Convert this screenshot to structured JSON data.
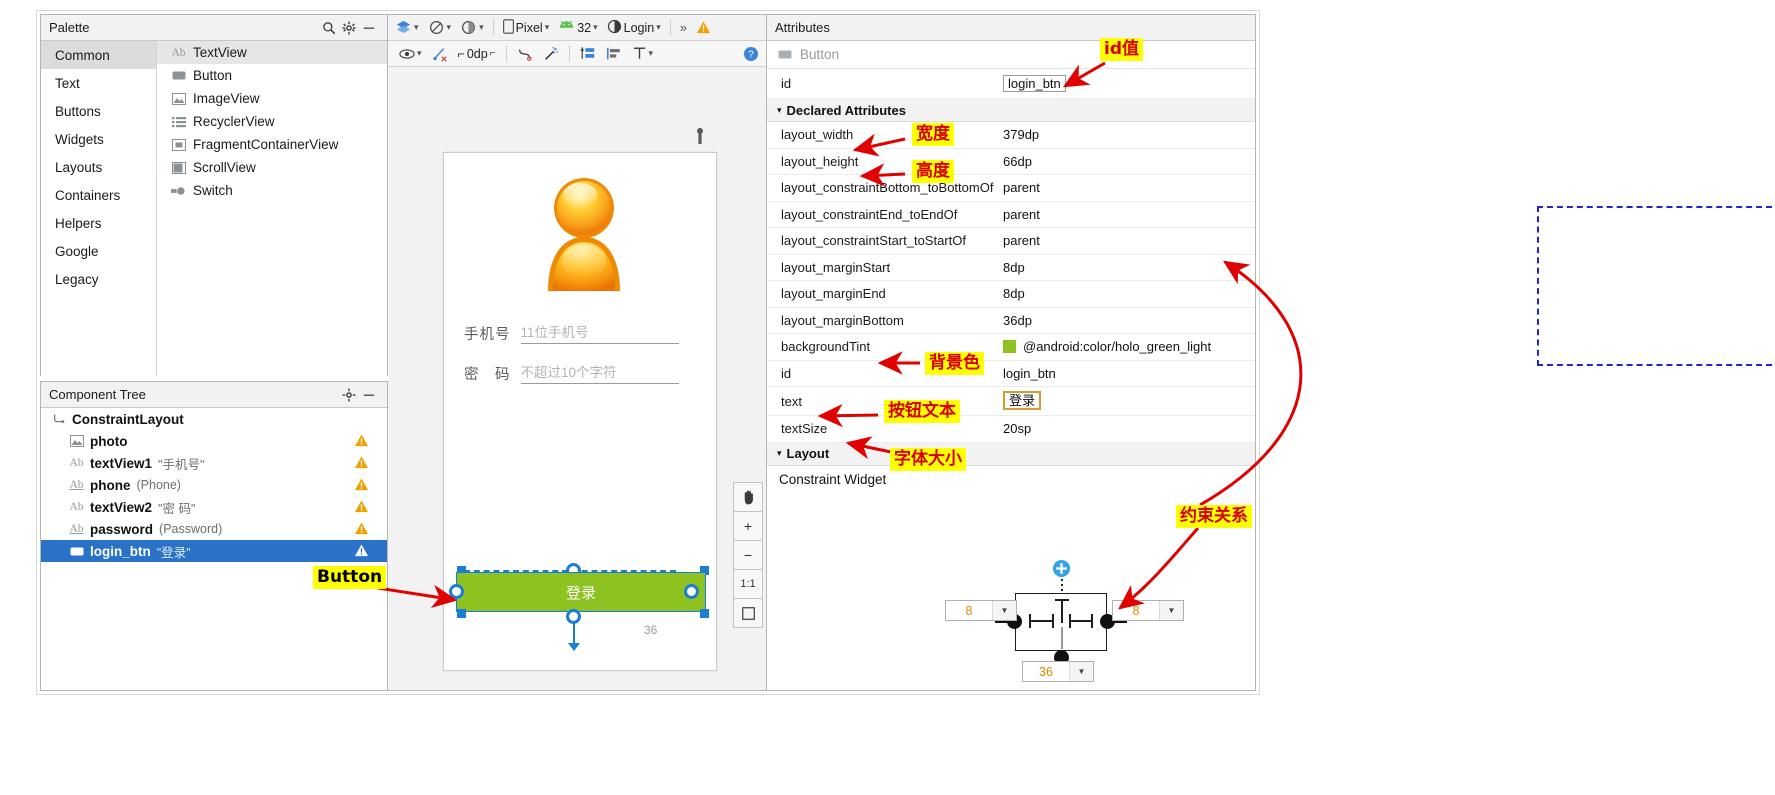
{
  "palette": {
    "title": "Palette",
    "icons": [
      "search-icon",
      "gear-icon",
      "minimize-icon"
    ],
    "categories": [
      {
        "label": "Common",
        "selected": true
      },
      {
        "label": "Text",
        "selected": false
      },
      {
        "label": "Buttons",
        "selected": false
      },
      {
        "label": "Widgets",
        "selected": false
      },
      {
        "label": "Layouts",
        "selected": false
      },
      {
        "label": "Containers",
        "selected": false
      },
      {
        "label": "Helpers",
        "selected": false
      },
      {
        "label": "Google",
        "selected": false
      },
      {
        "label": "Legacy",
        "selected": false
      }
    ],
    "items": [
      {
        "label": "TextView",
        "icon": "textview-icon",
        "selected": true
      },
      {
        "label": "Button",
        "icon": "button-icon",
        "selected": false
      },
      {
        "label": "ImageView",
        "icon": "imageview-icon",
        "selected": false
      },
      {
        "label": "RecyclerView",
        "icon": "recyclerview-icon",
        "selected": false
      },
      {
        "label": "FragmentContainerView",
        "icon": "fragment-icon",
        "selected": false
      },
      {
        "label": "ScrollView",
        "icon": "scrollview-icon",
        "selected": false
      },
      {
        "label": "Switch",
        "icon": "switch-icon",
        "selected": false
      }
    ]
  },
  "component_tree": {
    "title": "Component Tree",
    "icons": [
      "gear-icon",
      "minimize-icon"
    ],
    "nodes": [
      {
        "name": "ConstraintLayout",
        "qualifier": "",
        "icon": "constraintlayout-icon",
        "warning": false,
        "selected": false,
        "indent": 0
      },
      {
        "name": "photo",
        "qualifier": "",
        "icon": "imageview-icon",
        "warning": true,
        "selected": false,
        "indent": 1
      },
      {
        "name": "textView1",
        "qualifier": "\"手机号\"",
        "icon": "textview-icon",
        "warning": true,
        "selected": false,
        "indent": 1
      },
      {
        "name": "phone",
        "qualifier": "(Phone)",
        "icon": "edittext-icon",
        "warning": true,
        "selected": false,
        "indent": 1
      },
      {
        "name": "textView2",
        "qualifier": "\"密  码\"",
        "icon": "textview-icon",
        "warning": true,
        "selected": false,
        "indent": 1
      },
      {
        "name": "password",
        "qualifier": "(Password)",
        "icon": "edittext-icon",
        "warning": true,
        "selected": false,
        "indent": 1
      },
      {
        "name": "login_btn",
        "qualifier": "\"登录\"",
        "icon": "button-icon",
        "warning": true,
        "selected": true,
        "indent": 1
      }
    ]
  },
  "editor_toolbar": {
    "row1": [
      {
        "label": "",
        "icon": "layers-icon"
      },
      {
        "label": "",
        "icon": "orientation-icon"
      },
      {
        "label": "",
        "icon": "theme-icon"
      },
      {
        "label": "Pixel",
        "icon": "device-icon"
      },
      {
        "label": "32",
        "icon": "android-api-icon"
      },
      {
        "label": "Login",
        "icon": "theme-contrast-icon"
      },
      {
        "label": "»",
        "icon": "overflow-icon"
      },
      {
        "label": "",
        "icon": "warning-icon"
      }
    ],
    "row2": [
      {
        "label": "",
        "icon": "eye-icon"
      },
      {
        "label": "",
        "icon": "clear-constraints-icon"
      },
      {
        "label": "0dp",
        "icon": "default-margin-icon"
      },
      {
        "label": "",
        "icon": "infer-constraints-icon"
      },
      {
        "label": "",
        "icon": "magic-icon"
      },
      {
        "label": "",
        "icon": "guideline-icon"
      },
      {
        "label": "",
        "icon": "align-icon"
      },
      {
        "label": "",
        "icon": "pack-icon"
      },
      {
        "label": "",
        "icon": "help-icon"
      }
    ]
  },
  "device_preview": {
    "phone_label": "手机号",
    "phone_hint": "11位手机号",
    "password_label": "密　码",
    "password_hint": "不超过10个字符",
    "login_button_text": "登录",
    "bottom_margin_badge": "36",
    "avatar_icon": "user-avatar-icon"
  },
  "canvas_tools": [
    {
      "icon": "pan-icon",
      "label": ""
    },
    {
      "icon": "zoom-in-icon",
      "label": "+"
    },
    {
      "icon": "zoom-out-icon",
      "label": "−"
    },
    {
      "icon": "zoom-actual-icon",
      "label": "1:1"
    },
    {
      "icon": "zoom-fit-icon",
      "label": ""
    }
  ],
  "attributes": {
    "title": "Attributes",
    "widget_type": "Button",
    "id_row": {
      "key": "id",
      "value": "login_btn"
    },
    "declared_section": {
      "label": "Declared Attributes",
      "expanded": true
    },
    "rows": [
      {
        "key": "layout_width",
        "value": "379dp",
        "kind": "text"
      },
      {
        "key": "layout_height",
        "value": "66dp",
        "kind": "text"
      },
      {
        "key": "layout_constraintBottom_toBottomOf",
        "value": "parent",
        "kind": "text"
      },
      {
        "key": "layout_constraintEnd_toEndOf",
        "value": "parent",
        "kind": "text"
      },
      {
        "key": "layout_constraintStart_toStartOf",
        "value": "parent",
        "kind": "text"
      },
      {
        "key": "layout_marginStart",
        "value": "8dp",
        "kind": "text"
      },
      {
        "key": "layout_marginEnd",
        "value": "8dp",
        "kind": "text"
      },
      {
        "key": "layout_marginBottom",
        "value": "36dp",
        "kind": "text"
      },
      {
        "key": "backgroundTint",
        "value": "@android:color/holo_green_light",
        "kind": "color",
        "color": "#8dc220"
      },
      {
        "key": "id",
        "value": "login_btn",
        "kind": "text"
      },
      {
        "key": "text",
        "value": "登录",
        "kind": "focused-field"
      },
      {
        "key": "textSize",
        "value": "20sp",
        "kind": "text"
      }
    ],
    "layout_section": {
      "label": "Layout",
      "expanded": true
    },
    "constraint_widget": {
      "label": "Constraint Widget",
      "start_margin": "8",
      "end_margin": "8",
      "bottom_margin": "36"
    }
  },
  "annotations": [
    {
      "text": "id值",
      "target": "id-field"
    },
    {
      "text": "宽度",
      "target": "layout-width"
    },
    {
      "text": "高度",
      "target": "layout-height"
    },
    {
      "text": "背景色",
      "target": "backgroundTint"
    },
    {
      "text": "按钮文本",
      "target": "text"
    },
    {
      "text": "字体大小",
      "target": "textSize"
    },
    {
      "text": "约束关系",
      "target": "constraint-rows"
    },
    {
      "text": "Button",
      "target": "login-btn-tree"
    }
  ],
  "colors": {
    "selection_blue": "#2a72c8",
    "button_green": "#8dc220",
    "annotation_bg": "#ffff00",
    "annotation_fg": "#d60000",
    "dashed_blue": "#2323d0",
    "warning_amber": "#f0a000"
  }
}
